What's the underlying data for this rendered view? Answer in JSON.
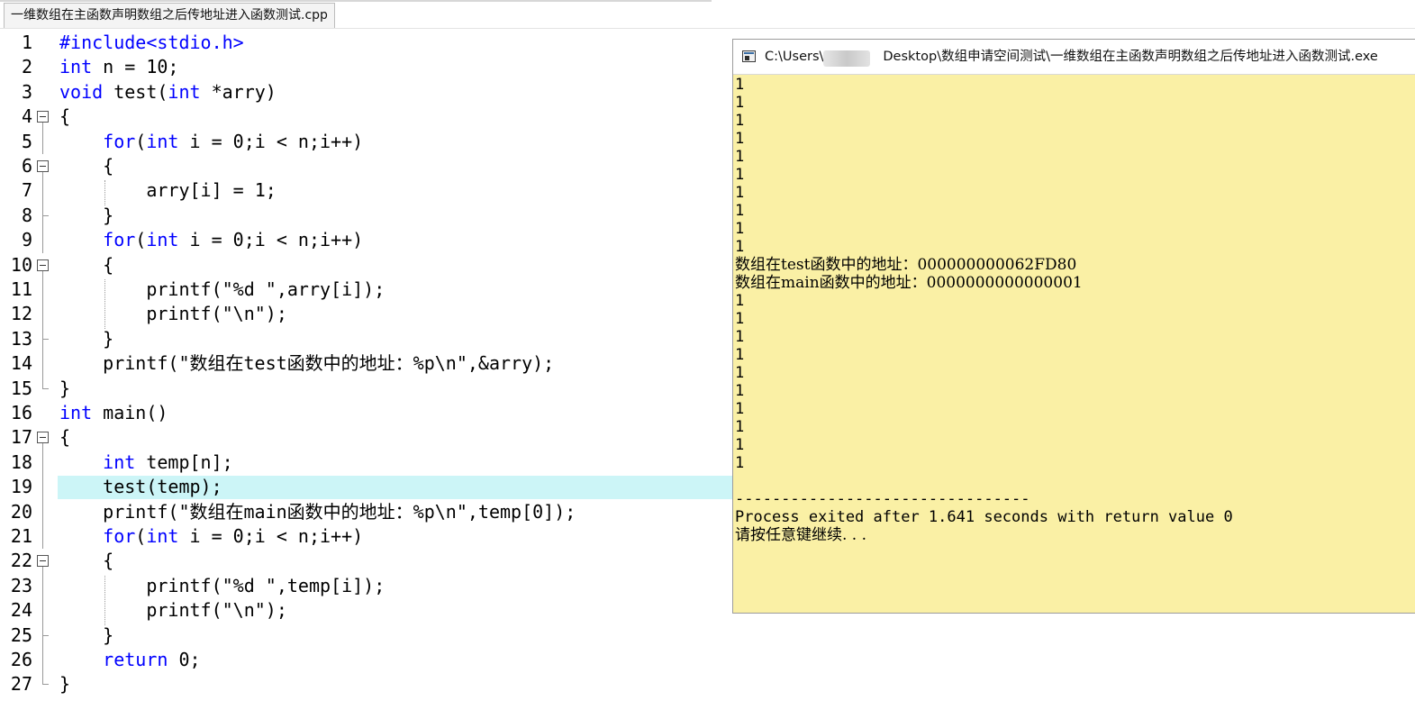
{
  "editor": {
    "tab_title": "一维数组在主函数声明数组之后传地址进入函数测试.cpp",
    "lines": [
      {
        "num": "1",
        "segs": [
          {
            "t": "#include<stdio.h>",
            "k": "kw"
          }
        ]
      },
      {
        "num": "2",
        "segs": [
          {
            "t": "int",
            "k": "kw"
          },
          {
            "t": " n = 10;"
          }
        ]
      },
      {
        "num": "3",
        "segs": [
          {
            "t": "void",
            "k": "kw"
          },
          {
            "t": " test("
          },
          {
            "t": "int",
            "k": "kw"
          },
          {
            "t": " *arry)"
          }
        ]
      },
      {
        "num": "4",
        "segs": [
          {
            "t": "{"
          }
        ]
      },
      {
        "num": "5",
        "segs": [
          {
            "t": "    "
          },
          {
            "t": "for",
            "k": "kw"
          },
          {
            "t": "("
          },
          {
            "t": "int",
            "k": "kw"
          },
          {
            "t": " i = 0;i < n;i++)"
          }
        ]
      },
      {
        "num": "6",
        "segs": [
          {
            "t": "    {"
          }
        ]
      },
      {
        "num": "7",
        "segs": [
          {
            "t": "        arry[i] = 1;"
          }
        ]
      },
      {
        "num": "8",
        "segs": [
          {
            "t": "    }"
          }
        ]
      },
      {
        "num": "9",
        "segs": [
          {
            "t": "    "
          },
          {
            "t": "for",
            "k": "kw"
          },
          {
            "t": "("
          },
          {
            "t": "int",
            "k": "kw"
          },
          {
            "t": " i = 0;i < n;i++)"
          }
        ]
      },
      {
        "num": "10",
        "segs": [
          {
            "t": "    {"
          }
        ]
      },
      {
        "num": "11",
        "segs": [
          {
            "t": "        printf(\"%d \",arry[i]);"
          }
        ]
      },
      {
        "num": "12",
        "segs": [
          {
            "t": "        printf(\"\\n\");"
          }
        ]
      },
      {
        "num": "13",
        "segs": [
          {
            "t": "    }"
          }
        ]
      },
      {
        "num": "14",
        "segs": [
          {
            "t": "    printf(\""
          },
          {
            "t": "数组在",
            "k": "cn"
          },
          {
            "t": "test"
          },
          {
            "t": "函数中的地址：",
            "k": "cn"
          },
          {
            "t": "%p\\n\",&arry);"
          }
        ]
      },
      {
        "num": "15",
        "segs": [
          {
            "t": "}"
          }
        ]
      },
      {
        "num": "16",
        "segs": [
          {
            "t": "int",
            "k": "kw"
          },
          {
            "t": " main()"
          }
        ]
      },
      {
        "num": "17",
        "segs": [
          {
            "t": "{"
          }
        ]
      },
      {
        "num": "18",
        "segs": [
          {
            "t": "    "
          },
          {
            "t": "int",
            "k": "kw"
          },
          {
            "t": " temp[n];"
          }
        ]
      },
      {
        "num": "19",
        "segs": [
          {
            "t": "    test(temp);"
          }
        ],
        "current": true
      },
      {
        "num": "20",
        "segs": [
          {
            "t": "    printf(\""
          },
          {
            "t": "数组在",
            "k": "cn"
          },
          {
            "t": "main"
          },
          {
            "t": "函数中的地址：",
            "k": "cn"
          },
          {
            "t": "%p\\n\",temp[0]);"
          }
        ]
      },
      {
        "num": "21",
        "segs": [
          {
            "t": "    "
          },
          {
            "t": "for",
            "k": "kw"
          },
          {
            "t": "("
          },
          {
            "t": "int",
            "k": "kw"
          },
          {
            "t": " i = 0;i < n;i++)"
          }
        ]
      },
      {
        "num": "22",
        "segs": [
          {
            "t": "    {"
          }
        ]
      },
      {
        "num": "23",
        "segs": [
          {
            "t": "        printf(\"%d \",temp[i]);"
          }
        ]
      },
      {
        "num": "24",
        "segs": [
          {
            "t": "        printf(\"\\n\");"
          }
        ]
      },
      {
        "num": "25",
        "segs": [
          {
            "t": "    }"
          }
        ]
      },
      {
        "num": "26",
        "segs": [
          {
            "t": "    "
          },
          {
            "t": "return",
            "k": "kw"
          },
          {
            "t": " 0;"
          }
        ]
      },
      {
        "num": "27",
        "segs": [
          {
            "t": "}"
          }
        ]
      }
    ]
  },
  "console": {
    "title_prefix": "C:\\Users\\",
    "title_suffix": "Desktop\\数组申请空间测试\\一维数组在主函数声明数组之后传地址进入函数测试.exe",
    "output": [
      "1",
      "1",
      "1",
      "1",
      "1",
      "1",
      "1",
      "1",
      "1",
      "1",
      "数组在test函数中的地址：000000000062FD80",
      "数组在main函数中的地址：0000000000000001",
      "1",
      "1",
      "1",
      "1",
      "1",
      "1",
      "1",
      "1",
      "1",
      "1",
      "",
      "--------------------------------",
      "Process exited after 1.641 seconds with return value 0",
      "请按任意键继续. . ."
    ]
  }
}
